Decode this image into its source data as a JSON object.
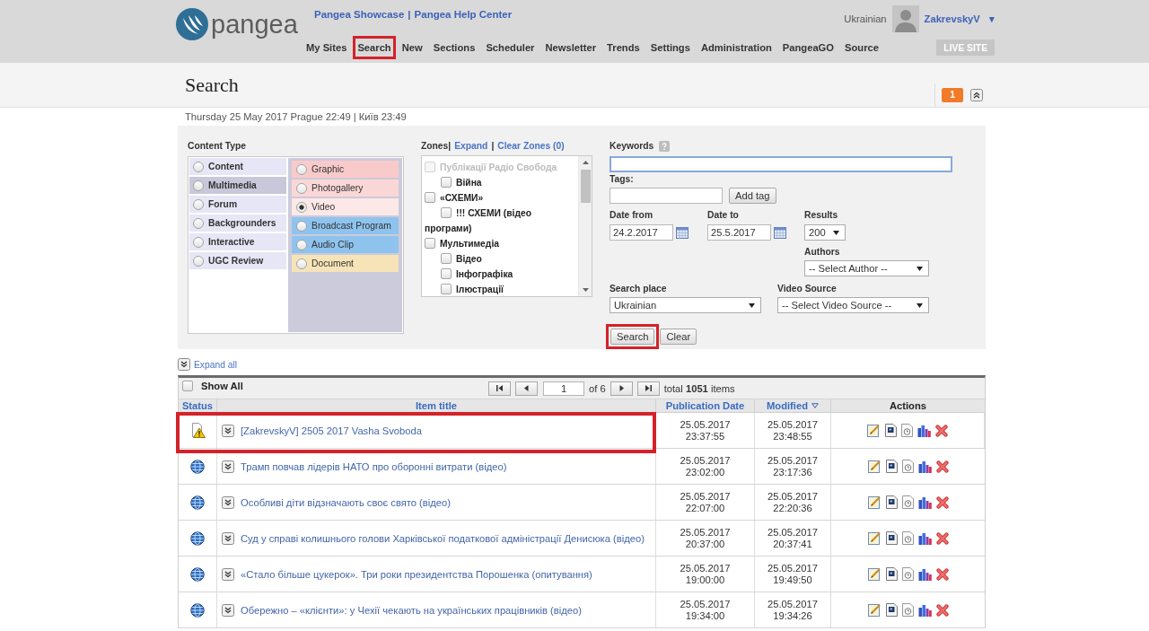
{
  "header": {
    "logo": "pangea",
    "links": [
      "Pangea Showcase",
      "Pangea Help Center"
    ],
    "link_separator": "|",
    "nav": [
      {
        "label": "My Sites",
        "highlighted": false
      },
      {
        "label": "Search",
        "highlighted": true
      },
      {
        "label": "New",
        "highlighted": false
      },
      {
        "label": "Sections",
        "highlighted": false
      },
      {
        "label": "Scheduler",
        "highlighted": false
      },
      {
        "label": "Newsletter",
        "highlighted": false
      },
      {
        "label": "Trends",
        "highlighted": false
      },
      {
        "label": "Settings",
        "highlighted": false
      },
      {
        "label": "Administration",
        "highlighted": false
      },
      {
        "label": "PangeaGO",
        "highlighted": false
      },
      {
        "label": "Source",
        "highlighted": false
      }
    ],
    "language": "Ukrainian",
    "user": "ZakrevskyV",
    "user_menu_caret": "▼",
    "live_site": "LIVE SITE"
  },
  "page_header": {
    "title": "Search",
    "badge": "1"
  },
  "datetime": "Thursday 25 May 2017 Prague 22:49 | Київ 23:49",
  "filters": {
    "content_type": {
      "label": "Content Type",
      "types": [
        {
          "label": "Content",
          "selected": false
        },
        {
          "label": "Multimedia",
          "selected": true
        },
        {
          "label": "Forum",
          "selected": false
        },
        {
          "label": "Backgrounders",
          "selected": false
        },
        {
          "label": "Interactive",
          "selected": false
        },
        {
          "label": "UGC Review",
          "selected": false
        }
      ],
      "subtypes": [
        {
          "label": "Graphic",
          "selected": false,
          "color": "#f9caca"
        },
        {
          "label": "Photogallery",
          "selected": false,
          "color": "#fbd6d6"
        },
        {
          "label": "Video",
          "selected": true,
          "color": "#fde8e8"
        },
        {
          "label": "Broadcast Program",
          "selected": false,
          "color": "#8ec3ee"
        },
        {
          "label": "Audio Clip",
          "selected": false,
          "color": "#8ec3ee"
        },
        {
          "label": "Document",
          "selected": false,
          "color": "#f6e4b8"
        }
      ]
    },
    "zones": {
      "label": "Zones|",
      "expand": "Expand",
      "separator": "|",
      "clear": "Clear Zones (0)",
      "tree": [
        {
          "label": "Публікації Радіо Свобода",
          "checked": false,
          "disabled": true,
          "children": [
            {
              "label": "Війна",
              "checked": false,
              "disabled": false
            }
          ]
        },
        {
          "label": "«СХЕМИ»",
          "checked": false,
          "disabled": false,
          "children": [
            {
              "label": "!!! СХЕМИ (відео програми)",
              "checked": false,
              "disabled": false
            }
          ]
        },
        {
          "label": "Мультимедіа",
          "checked": false,
          "disabled": false,
          "children": [
            {
              "label": "Відео",
              "checked": false,
              "disabled": false
            },
            {
              "label": "Інфографіка",
              "checked": false,
              "disabled": false
            },
            {
              "label": "Ілюстрації",
              "checked": false,
              "disabled": false
            }
          ]
        }
      ]
    },
    "keywords": {
      "label": "Keywords",
      "focused": true
    },
    "tags": {
      "label": "Tags:",
      "button": "Add tag"
    },
    "date_from": {
      "label": "Date from",
      "value": "24.2.2017"
    },
    "date_to": {
      "label": "Date to",
      "value": "25.5.2017"
    },
    "results": {
      "label": "Results",
      "value": "200"
    },
    "authors": {
      "label": "Authors",
      "value": "-- Select Author --"
    },
    "search_place": {
      "label": "Search place",
      "value": "Ukrainian"
    },
    "video_source": {
      "label": "Video Source",
      "value": "-- Select Video Source --"
    },
    "buttons": [
      {
        "label": "Search",
        "highlighted": true
      },
      {
        "label": "Clear",
        "highlighted": false
      }
    ]
  },
  "results_table": {
    "expand_all": "Expand all",
    "show_all": {
      "label": "Show All",
      "checked": false
    },
    "pagination": {
      "page": "1",
      "page_count": "of 6",
      "total": "total **1051** items"
    },
    "columns": [
      {
        "label": "Status",
        "sortable": true,
        "sorted": false
      },
      {
        "label": "Item title",
        "sortable": true,
        "sorted": false
      },
      {
        "label": "Publication Date",
        "sortable": true,
        "sorted": false
      },
      {
        "label": "Modified",
        "sortable": true,
        "sorted": true
      },
      {
        "label": "Actions",
        "sortable": false,
        "sorted": false
      }
    ],
    "rows": [
      {
        "kind": "warning",
        "title": "[ZakrevskyV] 2505 2017 Vasha Svoboda",
        "published": "25.05.2017 23:37:55",
        "modified": "25.05.2017 23:48:55",
        "highlighted": true
      },
      {
        "kind": "published",
        "title": "Трамп повчав лідерів НАТО про оборонні витрати (відео)",
        "published": "25.05.2017 23:02:00",
        "modified": "25.05.2017 23:17:36",
        "highlighted": false
      },
      {
        "kind": "published",
        "title": "Особливі діти відзначають своє свято (відео)",
        "published": "25.05.2017 22:07:00",
        "modified": "25.05.2017 22:20:36",
        "highlighted": false
      },
      {
        "kind": "published",
        "title": "Суд у справі колишнього голови Харківської податкової адміністрації Денисюка (відео)",
        "published": "25.05.2017 20:37:00",
        "modified": "25.05.2017 20:37:41",
        "highlighted": false
      },
      {
        "kind": "published",
        "title": "«Стало більше цукерок». Три роки президентства Порошенка (опитування)",
        "published": "25.05.2017 19:00:00",
        "modified": "25.05.2017 19:49:50",
        "highlighted": false
      },
      {
        "kind": "published",
        "title": "Обережно – «клієнти»: у Чехії чекають на українських працівників (відео)",
        "published": "25.05.2017 19:34:00",
        "modified": "25.05.2017 19:34:26",
        "highlighted": false
      }
    ]
  }
}
